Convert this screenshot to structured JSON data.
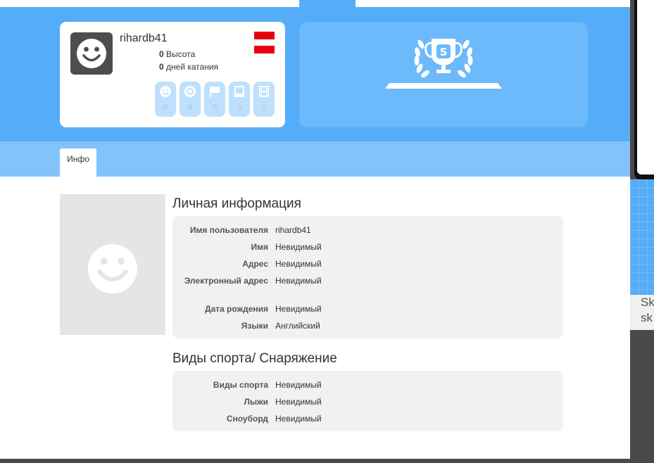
{
  "profile": {
    "username": "rihardb41",
    "height_value": "0",
    "height_label": "Высота",
    "days_value": "0",
    "days_label": "дней катания",
    "badges": [
      {
        "icon": "smiley-icon",
        "count": "0"
      },
      {
        "icon": "target-icon",
        "count": "0"
      },
      {
        "icon": "flag-icon",
        "count": "0"
      },
      {
        "icon": "photo-icon",
        "count": "0"
      },
      {
        "icon": "film-icon",
        "count": "0"
      }
    ],
    "flag_colors": [
      "#e8000e",
      "#ffffff",
      "#e8000e"
    ]
  },
  "award": {
    "icon": "trophy-laurel-icon",
    "letter": "S"
  },
  "tabs": [
    {
      "label": "Инфо",
      "active": true
    }
  ],
  "personal": {
    "title": "Личная информация",
    "rows": [
      {
        "label": "Имя пользователя",
        "value": "rihardb41"
      },
      {
        "label": "Имя",
        "value": "Невидимый"
      },
      {
        "label": "Адрес",
        "value": "Невидимый"
      },
      {
        "label": "Электронный адрес",
        "value": "Невидимый"
      },
      {
        "label": "Дата рождения",
        "value": "Невидимый"
      },
      {
        "label": "Языки",
        "value": "Английский"
      }
    ]
  },
  "sports": {
    "title": "Виды спорта/ Снаряжение",
    "rows": [
      {
        "label": "Виды спорта",
        "value": "Невидимый"
      },
      {
        "label": "Лыжи",
        "value": "Невидимый"
      },
      {
        "label": "Сноуборд",
        "value": "Невидимый"
      }
    ]
  },
  "side_text": "Sk sk",
  "colors": {
    "primary": "#55acf8",
    "tabbar": "#83c3fb",
    "badge": "#bfe0fd",
    "award_card": "#6cb9fb",
    "panel": "#f1f1f1"
  }
}
